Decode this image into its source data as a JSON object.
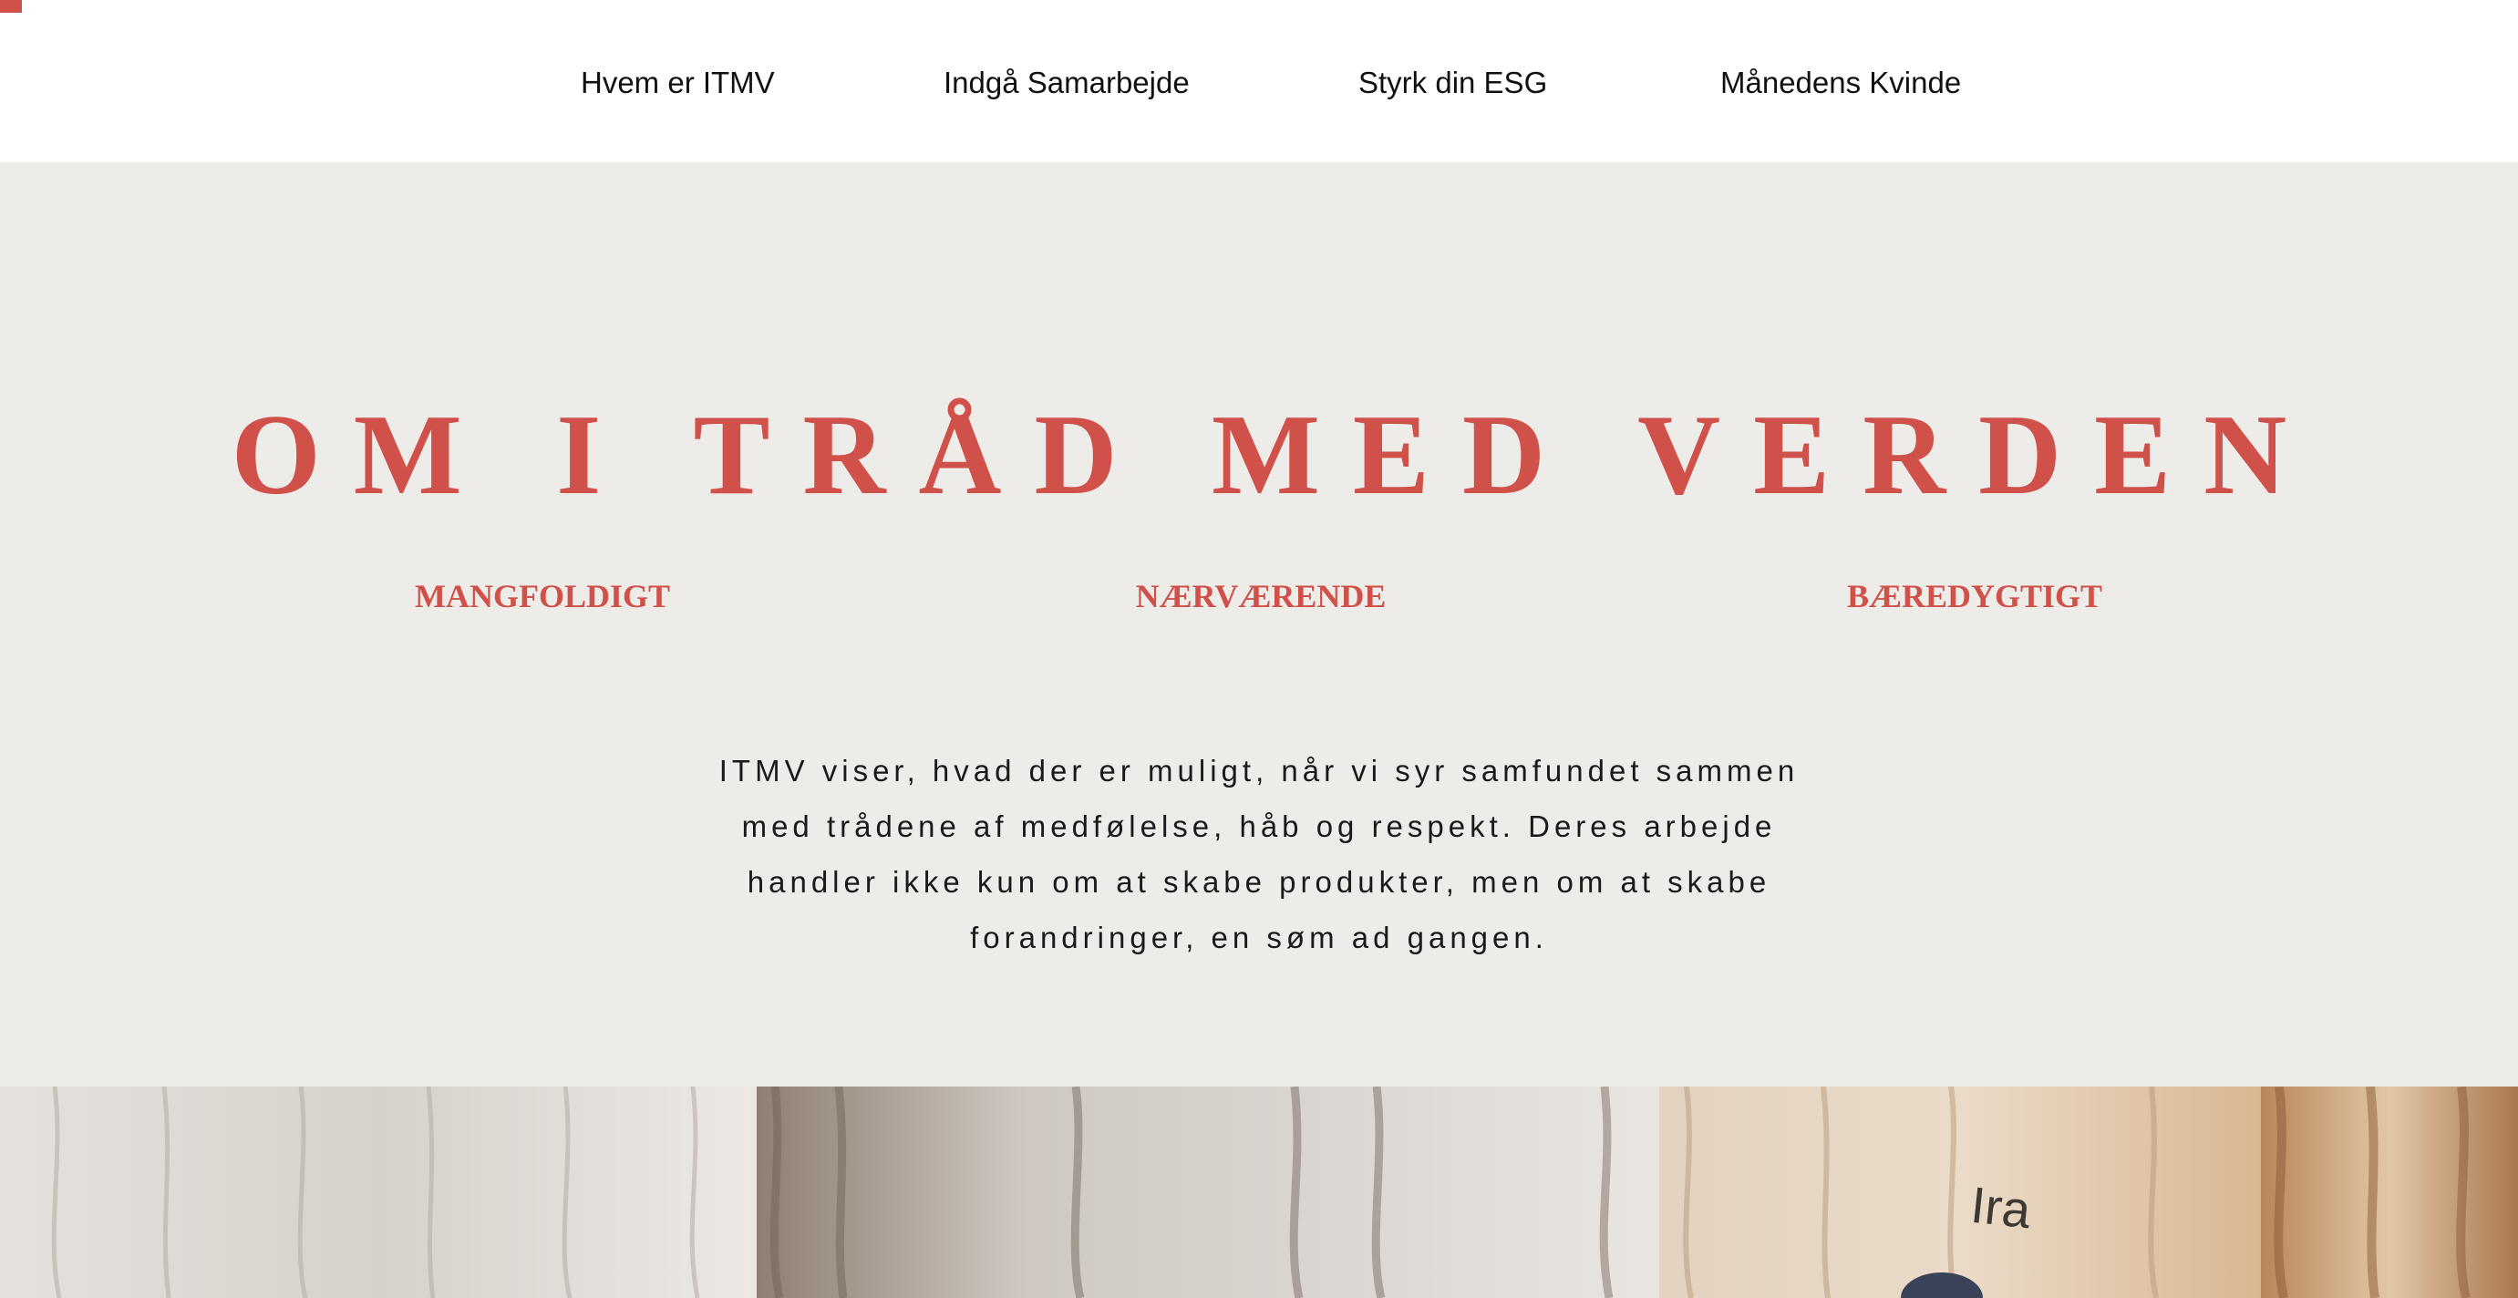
{
  "nav": {
    "items": [
      {
        "label": "Hvem er ITMV"
      },
      {
        "label": "Indgå Samarbejde"
      },
      {
        "label": "Styrk din ESG"
      },
      {
        "label": "Månedens Kvinde"
      }
    ]
  },
  "hero": {
    "title": "OM I TRÅD MED VERDEN",
    "values": [
      {
        "label": "MANGFOLDIGT"
      },
      {
        "label": "NÆRVÆRENDE"
      },
      {
        "label": "BÆREDYGTIGT"
      }
    ],
    "description": "ITMV viser, hvad der er muligt, når vi syr samfundet sammen med trådene af medfølelse, håb og respekt. Deres arbejde handler ikke kun om at skabe produkter, men om at skabe forandringer, en søm ad gangen."
  },
  "photo": {
    "visible_text": "Ira"
  },
  "colors": {
    "accent": "#d0504a",
    "hero_background": "#eeece9",
    "text": "#111111"
  }
}
